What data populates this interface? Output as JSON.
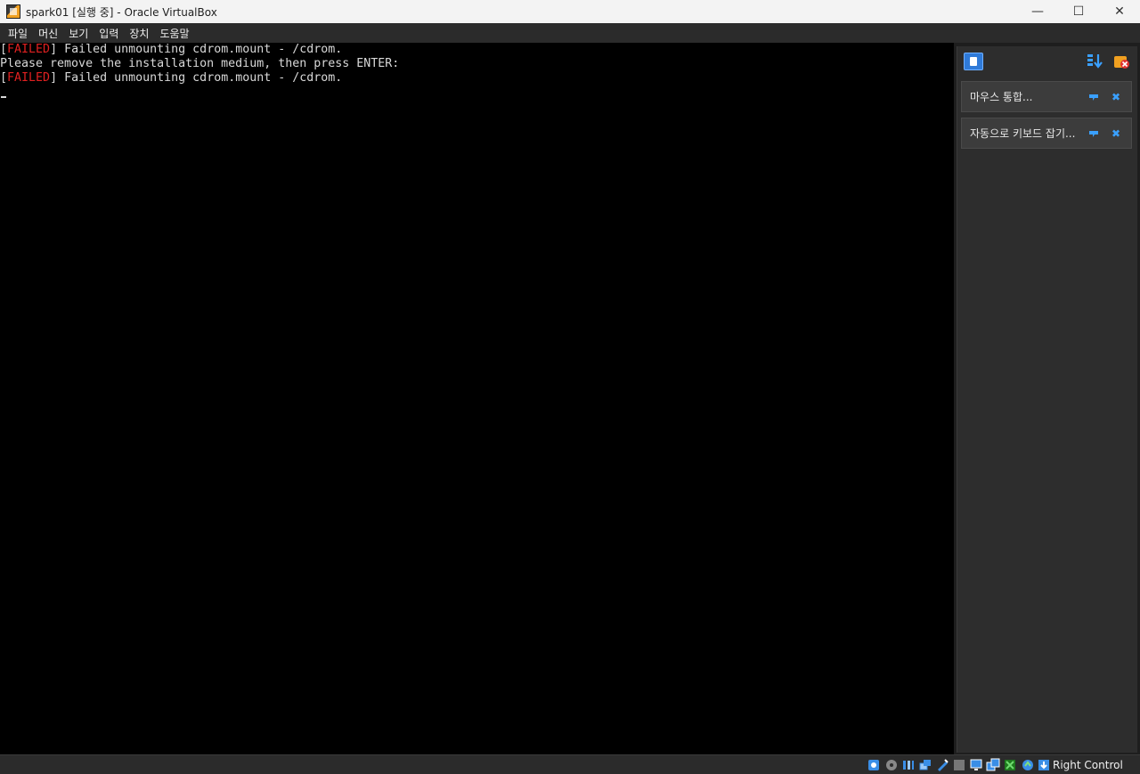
{
  "window": {
    "title": "spark01 [실행 중] - Oracle VirtualBox",
    "controls": {
      "minimize": "—",
      "maximize": "☐",
      "close": "✕"
    }
  },
  "menu": {
    "items": [
      "파일",
      "머신",
      "보기",
      "입력",
      "장치",
      "도움말"
    ]
  },
  "console": {
    "lines": [
      {
        "bracket_open": "[",
        "status": "FAILED",
        "bracket_close": "]",
        "text": " Failed unmounting cdrom.mount - /cdrom."
      },
      {
        "text": "Please remove the installation medium, then press ENTER:"
      },
      {
        "bracket_open": "[",
        "status": "FAILED",
        "bracket_close": "]",
        "text": " Failed unmounting cdrom.mount - /cdrom."
      }
    ],
    "colors": {
      "text": "#d8d8d8",
      "failed": "#e02020",
      "background": "#000000"
    }
  },
  "notifications": {
    "toggle_icon": "notification-center-icon",
    "sort_icon": "sort-order-icon",
    "dismiss_all_icon": "dismiss-all-icon",
    "items": [
      {
        "text": "마우스 통합...",
        "pin_icon": "keep-icon",
        "close_icon": "close-icon"
      },
      {
        "text": "자동으로 키보드 잡기...",
        "pin_icon": "keep-icon",
        "close_icon": "close-icon"
      }
    ],
    "close_glyph": "✖"
  },
  "statusbar": {
    "icons": [
      "hard-disk-icon",
      "optical-drive-icon",
      "audio-icon",
      "network-icon",
      "usb-icon",
      "shared-folders-icon",
      "display-icon",
      "recording-icon",
      "cpu-icon",
      "mouse-integration-icon",
      "keyboard-capture-icon"
    ],
    "host_key": "Right Control"
  }
}
